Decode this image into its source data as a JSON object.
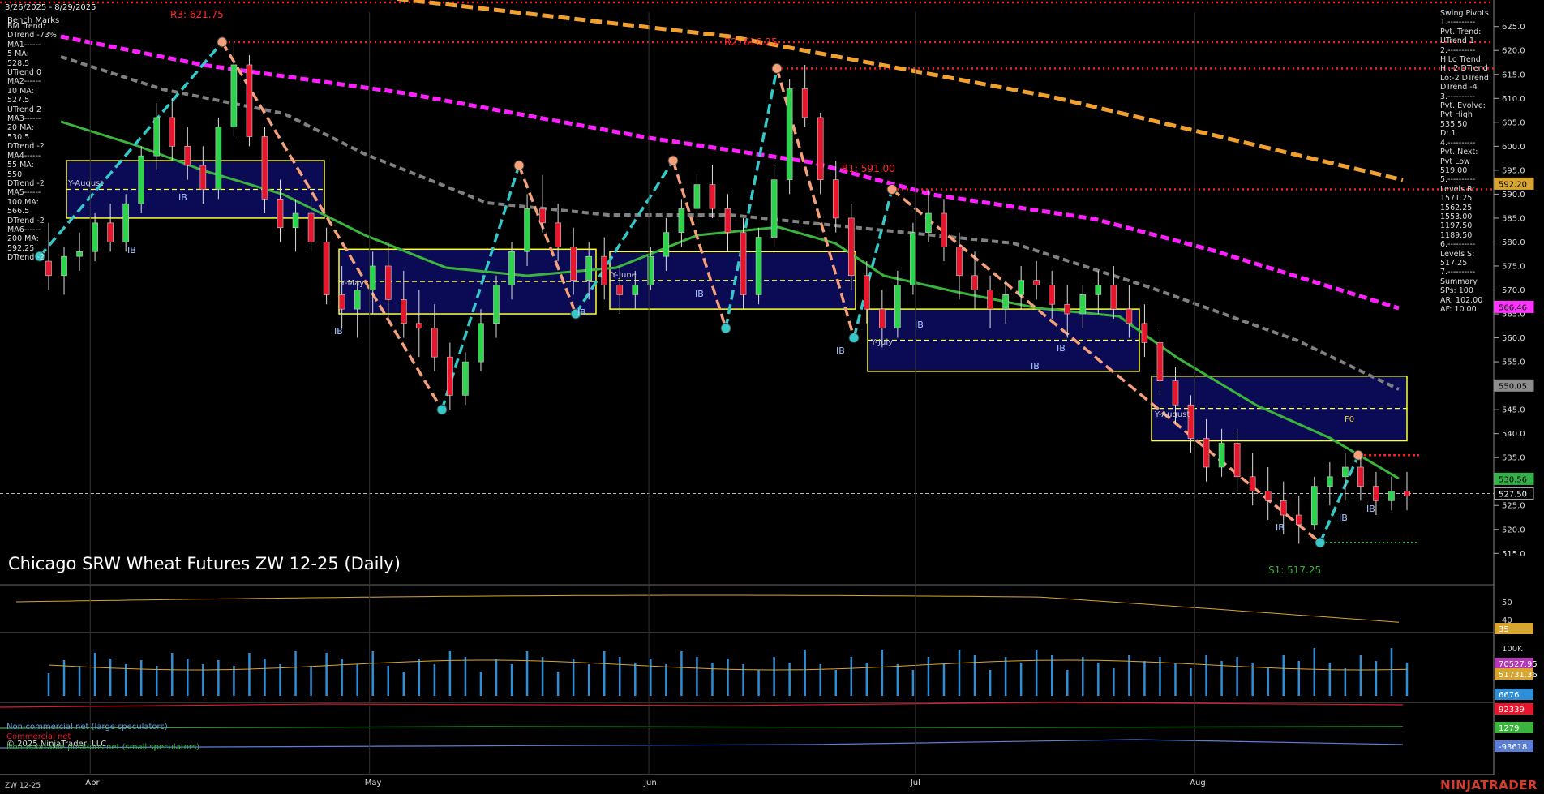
{
  "header": {
    "date_range": "3/26/2025 - 8/29/2025"
  },
  "title": "Chicago SRW Wheat Futures ZW 12-25 (Daily)",
  "symbol": "ZW 12-25",
  "brand": "NINJATRADER",
  "copyright": "© 2025 NinjaTrader, LLC",
  "left_panel": {
    "heading": "Bench Marks",
    "lines": [
      "BM Trend:",
      "DTrend -73%",
      "MA1------",
      "5 MA:",
      "528.5",
      "UTrend 0",
      "MA2------",
      "10 MA:",
      "527.5",
      "UTrend 2",
      "MA3------",
      "20 MA:",
      "530.5",
      "DTrend -2",
      "MA4------",
      "55 MA:",
      "550",
      "DTrend -2",
      "MA5------",
      "100 MA:",
      "566.5",
      "DTrend -2",
      "MA6------",
      "200 MA:",
      "592.25",
      "DTrend -2"
    ]
  },
  "right_panel": {
    "lines": [
      "Swing Pivots",
      "1.----------",
      "Pvt. Trend:",
      "UTrend 1",
      "2.----------",
      "HiLo Trend:",
      "Hi:-2 DTrend",
      "Lo:-2 DTrend",
      "DTrend -4",
      "3.----------",
      "Pvt. Evolve:",
      "Pvt High",
      "535.50",
      "D: 1",
      "4.----------",
      "Pvt. Next:",
      "Pvt Low",
      "519.00",
      "5.----------",
      "Levels R:",
      "1571.25",
      "1562.25",
      "1553.00",
      "1197.50",
      "1189.50",
      "6.----------",
      "Levels S:",
      "517.25",
      "7.----------",
      "Summary",
      "SPs: 100",
      "AR: 102.00",
      "AF: 10.00"
    ]
  },
  "annotations": {
    "r3": "R3: 621.75",
    "r2": "R2: 616.25",
    "r1": "R1: 591.00",
    "s1": "S1: 517.25",
    "ib": "IB",
    "f0": "F0",
    "month_vwaps": [
      "Y-August",
      "Y-May",
      "Y-June",
      "Y-July",
      "Y-August"
    ]
  },
  "price_tags": [
    {
      "text": "592.20",
      "color": "#d8a531",
      "value": 592.2
    },
    {
      "text": "566.46",
      "color": "#ff33ff",
      "value": 566.46
    },
    {
      "text": "550.05",
      "color": "#8c8c8c",
      "value": 550.05
    },
    {
      "text": "530.56",
      "color": "#35b04a",
      "value": 530.56
    },
    {
      "text": "527.50",
      "color": "#000000",
      "value": 527.5
    }
  ],
  "sub_tags": {
    "adx": {
      "text": "35",
      "color": "#d8a531"
    },
    "vol1": {
      "text": "70527.95",
      "color": "#b637b5"
    },
    "vol2": {
      "text": "51731.36",
      "color": "#d8a531"
    },
    "vol3": {
      "text": "6676",
      "color": "#2e8ed8"
    },
    "cot1": {
      "text": "92339",
      "color": "#e8162c"
    },
    "cot2": {
      "text": "1279",
      "color": "#3ab43c"
    },
    "cot3": {
      "text": "-93618",
      "color": "#5b7fd8"
    }
  },
  "cot_legend": {
    "noncommercial": "Non-commercial net (large speculators)",
    "commercial": "Commercial net",
    "nonreportable": "Nonreportable positions net (small speculators)"
  },
  "colors": {
    "up_candle": "#2bd44a",
    "down_candle": "#e8162c",
    "ma200": "#f0a030",
    "ma100": "#ff20ff",
    "ma55": "#808080",
    "ma20": "#3ab43c",
    "resistance": "#ff1e1e",
    "support": "#3ab43c",
    "zigzag_up": "#35c8c8",
    "zigzag_down": "#f4a07a",
    "box": "#ffff33",
    "box_fill": "#0a0a55"
  },
  "chart_data": {
    "type": "candlestick",
    "title": "Chicago SRW Wheat Futures ZW 12-25 (Daily)",
    "x_range": [
      "2025-03-26",
      "2025-08-29"
    ],
    "x_ticks": [
      "Apr",
      "May",
      "Jun",
      "Jul",
      "Aug"
    ],
    "y_ticks": [
      515.0,
      520.0,
      525.0,
      530.0,
      535.0,
      540.0,
      545.0,
      550.0,
      555.0,
      560.0,
      565.0,
      570.0,
      575.0,
      580.0,
      585.0,
      590.0,
      595.0,
      600.0,
      605.0,
      610.0,
      615.0,
      620.0,
      625.0
    ],
    "ylim": [
      512,
      628
    ],
    "levels": {
      "R3": 621.75,
      "R2": 616.25,
      "R1": 591.0,
      "S1": 517.25,
      "last_close": 527.5
    },
    "ohlc": [
      [
        576,
        584,
        570,
        573
      ],
      [
        573,
        579,
        569,
        577
      ],
      [
        577,
        582,
        574,
        578
      ],
      [
        578,
        586,
        576,
        584
      ],
      [
        584,
        588,
        578,
        580
      ],
      [
        580,
        590,
        578,
        588
      ],
      [
        588,
        600,
        586,
        598
      ],
      [
        598,
        609,
        595,
        606
      ],
      [
        606,
        610,
        597,
        600
      ],
      [
        600,
        604,
        593,
        596
      ],
      [
        596,
        600,
        588,
        591
      ],
      [
        591,
        606,
        589,
        604
      ],
      [
        604,
        622,
        602,
        617
      ],
      [
        617,
        619,
        600,
        602
      ],
      [
        602,
        604,
        586,
        589
      ],
      [
        589,
        593,
        580,
        583
      ],
      [
        583,
        589,
        578,
        586
      ],
      [
        586,
        590,
        578,
        580
      ],
      [
        580,
        583,
        567,
        569
      ],
      [
        569,
        575,
        562,
        566
      ],
      [
        566,
        572,
        560,
        570
      ],
      [
        570,
        578,
        565,
        575
      ],
      [
        575,
        580,
        564,
        568
      ],
      [
        568,
        574,
        560,
        563
      ],
      [
        563,
        570,
        556,
        562
      ],
      [
        562,
        567,
        553,
        556
      ],
      [
        556,
        559,
        545,
        548
      ],
      [
        548,
        557,
        546,
        555
      ],
      [
        555,
        566,
        553,
        563
      ],
      [
        563,
        573,
        560,
        571
      ],
      [
        571,
        580,
        568,
        578
      ],
      [
        578,
        590,
        575,
        587
      ],
      [
        587,
        594,
        582,
        584
      ],
      [
        584,
        588,
        576,
        579
      ],
      [
        579,
        583,
        569,
        572
      ],
      [
        572,
        580,
        568,
        577
      ],
      [
        577,
        581,
        568,
        571
      ],
      [
        571,
        575,
        565,
        569
      ],
      [
        569,
        574,
        566,
        571
      ],
      [
        571,
        579,
        570,
        577
      ],
      [
        577,
        585,
        574,
        582
      ],
      [
        582,
        589,
        579,
        587
      ],
      [
        587,
        594,
        585,
        592
      ],
      [
        592,
        596,
        585,
        587
      ],
      [
        587,
        590,
        578,
        582
      ],
      [
        582,
        585,
        566,
        569
      ],
      [
        569,
        583,
        567,
        581
      ],
      [
        581,
        596,
        579,
        593
      ],
      [
        593,
        614,
        590,
        612
      ],
      [
        612,
        617,
        604,
        606
      ],
      [
        606,
        607,
        590,
        593
      ],
      [
        593,
        597,
        582,
        585
      ],
      [
        585,
        588,
        570,
        573
      ],
      [
        573,
        576,
        563,
        566
      ],
      [
        566,
        570,
        558,
        562
      ],
      [
        562,
        574,
        560,
        571
      ],
      [
        571,
        584,
        569,
        582
      ],
      [
        582,
        591,
        580,
        586
      ],
      [
        586,
        589,
        576,
        579
      ],
      [
        579,
        582,
        568,
        573
      ],
      [
        573,
        578,
        566,
        570
      ],
      [
        570,
        573,
        562,
        566
      ],
      [
        566,
        572,
        563,
        569
      ],
      [
        569,
        575,
        566,
        572
      ],
      [
        572,
        576,
        568,
        571
      ],
      [
        571,
        574,
        564,
        567
      ],
      [
        567,
        571,
        560,
        565
      ],
      [
        565,
        571,
        562,
        569
      ],
      [
        569,
        574,
        565,
        571
      ],
      [
        571,
        575,
        564,
        566
      ],
      [
        566,
        571,
        560,
        563
      ],
      [
        563,
        567,
        556,
        559
      ],
      [
        559,
        562,
        548,
        551
      ],
      [
        551,
        554,
        542,
        546
      ],
      [
        546,
        548,
        536,
        539
      ],
      [
        539,
        543,
        530,
        533
      ],
      [
        533,
        541,
        531,
        538
      ],
      [
        538,
        541,
        528,
        531
      ],
      [
        531,
        536,
        525,
        528
      ],
      [
        528,
        533,
        522,
        526
      ],
      [
        526,
        530,
        519,
        523
      ],
      [
        523,
        527,
        517,
        521
      ],
      [
        521,
        531,
        520,
        529
      ],
      [
        529,
        534,
        525,
        531
      ],
      [
        531,
        536,
        526,
        533
      ],
      [
        533,
        535,
        526,
        529
      ],
      [
        529,
        532,
        523,
        526
      ],
      [
        526,
        531,
        524,
        528
      ],
      [
        528,
        532,
        524,
        527
      ]
    ]
  }
}
